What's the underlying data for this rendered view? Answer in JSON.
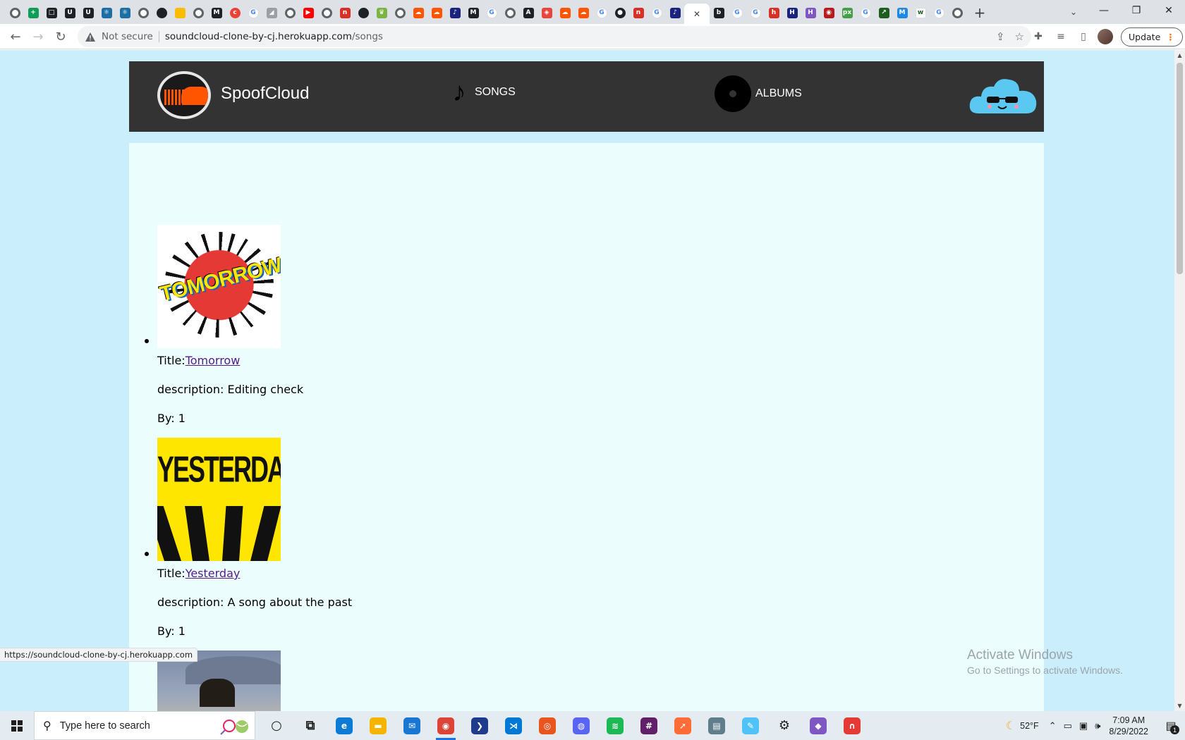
{
  "browser": {
    "tabs": [
      {
        "icon": "globe-icon",
        "color": "#5f6368",
        "round": true,
        "glyph": ""
      },
      {
        "icon": "plus-green-icon",
        "color": "#0f9d58",
        "round": false,
        "glyph": "+"
      },
      {
        "icon": "square-icon",
        "color": "#202124",
        "round": false,
        "glyph": "□"
      },
      {
        "icon": "u-yellow-icon",
        "color": "#202124",
        "round": false,
        "glyph": "U"
      },
      {
        "icon": "u-yellow-icon",
        "color": "#202124",
        "round": false,
        "glyph": "U"
      },
      {
        "icon": "react-icon",
        "color": "#1c6ea4",
        "round": false,
        "glyph": "⚛"
      },
      {
        "icon": "react-icon",
        "color": "#1c6ea4",
        "round": false,
        "glyph": "⚛"
      },
      {
        "icon": "globe-icon",
        "color": "#5f6368",
        "round": true,
        "glyph": ""
      },
      {
        "icon": "github-icon",
        "color": "#202124",
        "round": true,
        "glyph": ""
      },
      {
        "icon": "yellow-box-icon",
        "color": "#fbbc04",
        "round": false,
        "glyph": ""
      },
      {
        "icon": "globe-icon",
        "color": "#5f6368",
        "round": true,
        "glyph": ""
      },
      {
        "icon": "medium-icon",
        "color": "#202124",
        "round": false,
        "glyph": "M"
      },
      {
        "icon": "red-c-icon",
        "color": "#ea4335",
        "round": true,
        "glyph": "c"
      },
      {
        "icon": "google-icon",
        "color": "#ffffff",
        "round": true,
        "glyph": "G"
      },
      {
        "icon": "chart-icon",
        "color": "#9aa0a6",
        "round": false,
        "glyph": "◢"
      },
      {
        "icon": "globe-icon",
        "color": "#5f6368",
        "round": true,
        "glyph": ""
      },
      {
        "icon": "youtube-icon",
        "color": "#ff0000",
        "round": false,
        "glyph": "▶"
      },
      {
        "icon": "globe-icon",
        "color": "#5f6368",
        "round": true,
        "glyph": ""
      },
      {
        "icon": "red-n-icon",
        "color": "#d93025",
        "round": false,
        "glyph": "n"
      },
      {
        "icon": "github-icon",
        "color": "#202124",
        "round": true,
        "glyph": ""
      },
      {
        "icon": "hat-icon",
        "color": "#7cb342",
        "round": false,
        "glyph": "♛"
      },
      {
        "icon": "globe-icon",
        "color": "#5f6368",
        "round": true,
        "glyph": ""
      },
      {
        "icon": "soundcloud-icon",
        "color": "#ff5500",
        "round": false,
        "glyph": "☁"
      },
      {
        "icon": "soundcloud-icon",
        "color": "#ff5500",
        "round": false,
        "glyph": "☁"
      },
      {
        "icon": "blue-red-icon",
        "color": "#1a237e",
        "round": false,
        "glyph": "♪"
      },
      {
        "icon": "medium-icon",
        "color": "#202124",
        "round": false,
        "glyph": "M"
      },
      {
        "icon": "google-icon",
        "color": "#ffffff",
        "round": true,
        "glyph": "G"
      },
      {
        "icon": "globe-icon",
        "color": "#5f6368",
        "round": true,
        "glyph": ""
      },
      {
        "icon": "a-icon",
        "color": "#202124",
        "round": false,
        "glyph": "A"
      },
      {
        "icon": "red-orange-icon",
        "color": "#e8453c",
        "round": false,
        "glyph": "◈"
      },
      {
        "icon": "soundcloud-icon",
        "color": "#ff5500",
        "round": false,
        "glyph": "☁"
      },
      {
        "icon": "soundcloud-icon",
        "color": "#ff5500",
        "round": false,
        "glyph": "☁"
      },
      {
        "icon": "google-icon",
        "color": "#ffffff",
        "round": true,
        "glyph": "G"
      },
      {
        "icon": "dark-round-icon",
        "color": "#202124",
        "round": true,
        "glyph": "●"
      },
      {
        "icon": "red-n-icon",
        "color": "#d93025",
        "round": false,
        "glyph": "n"
      },
      {
        "icon": "google-icon",
        "color": "#ffffff",
        "round": true,
        "glyph": "G"
      },
      {
        "icon": "blue-red-icon",
        "color": "#1a237e",
        "round": false,
        "glyph": "♪"
      },
      {
        "icon": "close-icon",
        "color": "#ffffff",
        "round": false,
        "glyph": "✕",
        "active": true
      },
      {
        "icon": "bpm-icon",
        "color": "#202124",
        "round": false,
        "glyph": "b"
      },
      {
        "icon": "google-icon",
        "color": "#ffffff",
        "round": true,
        "glyph": "G"
      },
      {
        "icon": "google-icon",
        "color": "#ffffff",
        "round": true,
        "glyph": "G"
      },
      {
        "icon": "red-badge-icon",
        "color": "#d93025",
        "round": false,
        "glyph": "h"
      },
      {
        "icon": "h-blue-icon",
        "color": "#1a237e",
        "round": false,
        "glyph": "H"
      },
      {
        "icon": "h-purple-icon",
        "color": "#7e57c2",
        "round": false,
        "glyph": "H"
      },
      {
        "icon": "dark-red-icon",
        "color": "#b71c1c",
        "round": false,
        "glyph": "◉"
      },
      {
        "icon": "px-icon",
        "color": "#43a047",
        "round": false,
        "glyph": "px"
      },
      {
        "icon": "google-icon",
        "color": "#ffffff",
        "round": true,
        "glyph": "G"
      },
      {
        "icon": "green-arrow-icon",
        "color": "#1b5e20",
        "round": false,
        "glyph": "↗"
      },
      {
        "icon": "blue-ms-icon",
        "color": "#1e88e5",
        "round": false,
        "glyph": "M"
      },
      {
        "icon": "w-icon",
        "color": "#ffffff",
        "round": false,
        "glyph": "w"
      },
      {
        "icon": "google-icon",
        "color": "#ffffff",
        "round": true,
        "glyph": "G"
      },
      {
        "icon": "globe-icon",
        "color": "#5f6368",
        "round": true,
        "glyph": ""
      }
    ],
    "new_tab": "+",
    "address": {
      "security_label": "Not secure",
      "host": "soundcloud-clone-by-cj.herokuapp.com",
      "path": "/songs"
    },
    "update_label": "Update",
    "status_url": "https://soundcloud-clone-by-cj.herokuapp.com"
  },
  "site": {
    "brand": "SpoofCloud",
    "nav": {
      "songs": "SONGS",
      "albums": "ALBUMS"
    },
    "songs": [
      {
        "cover": "tomorrow",
        "cover_text": "TOMORROW",
        "title_label": "Title:",
        "title": "Tomorrow",
        "description_label": "description:",
        "description": "Editing check",
        "by_label": "By:",
        "by": "1"
      },
      {
        "cover": "yesterday",
        "cover_text": "YESTERDAY",
        "title_label": "Title:",
        "title": "Yesterday",
        "description_label": "description:",
        "description": "A song about the past",
        "by_label": "By:",
        "by": "1"
      },
      {
        "cover": "horse"
      }
    ]
  },
  "watermark": {
    "line1": "Activate Windows",
    "line2": "Go to Settings to activate Windows."
  },
  "taskbar": {
    "search_placeholder": "Type here to search",
    "apps": [
      {
        "name": "cortana-icon",
        "color": "transparent",
        "glyph": "○",
        "dark": true
      },
      {
        "name": "task-view-icon",
        "color": "transparent",
        "glyph": "⧉",
        "dark": true
      },
      {
        "name": "edge-icon",
        "color": "#0c7bd6",
        "glyph": "e"
      },
      {
        "name": "file-explorer-icon",
        "color": "#f4b400",
        "glyph": "▬"
      },
      {
        "name": "mail-icon",
        "color": "#1976d2",
        "glyph": "✉"
      },
      {
        "name": "chrome-icon",
        "color": "#db4437",
        "glyph": "◉",
        "active": true
      },
      {
        "name": "powershell-icon",
        "color": "#1e3a8a",
        "glyph": "❯"
      },
      {
        "name": "vscode-icon",
        "color": "#0078d4",
        "glyph": "⋊"
      },
      {
        "name": "ubuntu-icon",
        "color": "#e95420",
        "glyph": "◎"
      },
      {
        "name": "discord-icon",
        "color": "#5865f2",
        "glyph": "◍"
      },
      {
        "name": "spotify-icon",
        "color": "#1db954",
        "glyph": "≋"
      },
      {
        "name": "slack-icon",
        "color": "#611f69",
        "glyph": "#"
      },
      {
        "name": "postman-icon",
        "color": "#ff6c37",
        "glyph": "➚"
      },
      {
        "name": "printer-icon",
        "color": "#607d8b",
        "glyph": "▤"
      },
      {
        "name": "notepad-icon",
        "color": "#4fc3f7",
        "glyph": "✎"
      },
      {
        "name": "settings-icon",
        "color": "transparent",
        "glyph": "⚙",
        "dark": true
      },
      {
        "name": "paint-icon",
        "color": "#7e57c2",
        "glyph": "◆"
      },
      {
        "name": "magnet-icon",
        "color": "#e53935",
        "glyph": "∩"
      }
    ],
    "temperature": "52°F",
    "time": "7:09 AM",
    "date": "8/29/2022",
    "notification_count": "1"
  },
  "colors": {
    "viewport_bg": "#caeefb",
    "content_bg": "#ebfdfd",
    "navbar_bg": "#333333",
    "link": "#551a8b"
  }
}
